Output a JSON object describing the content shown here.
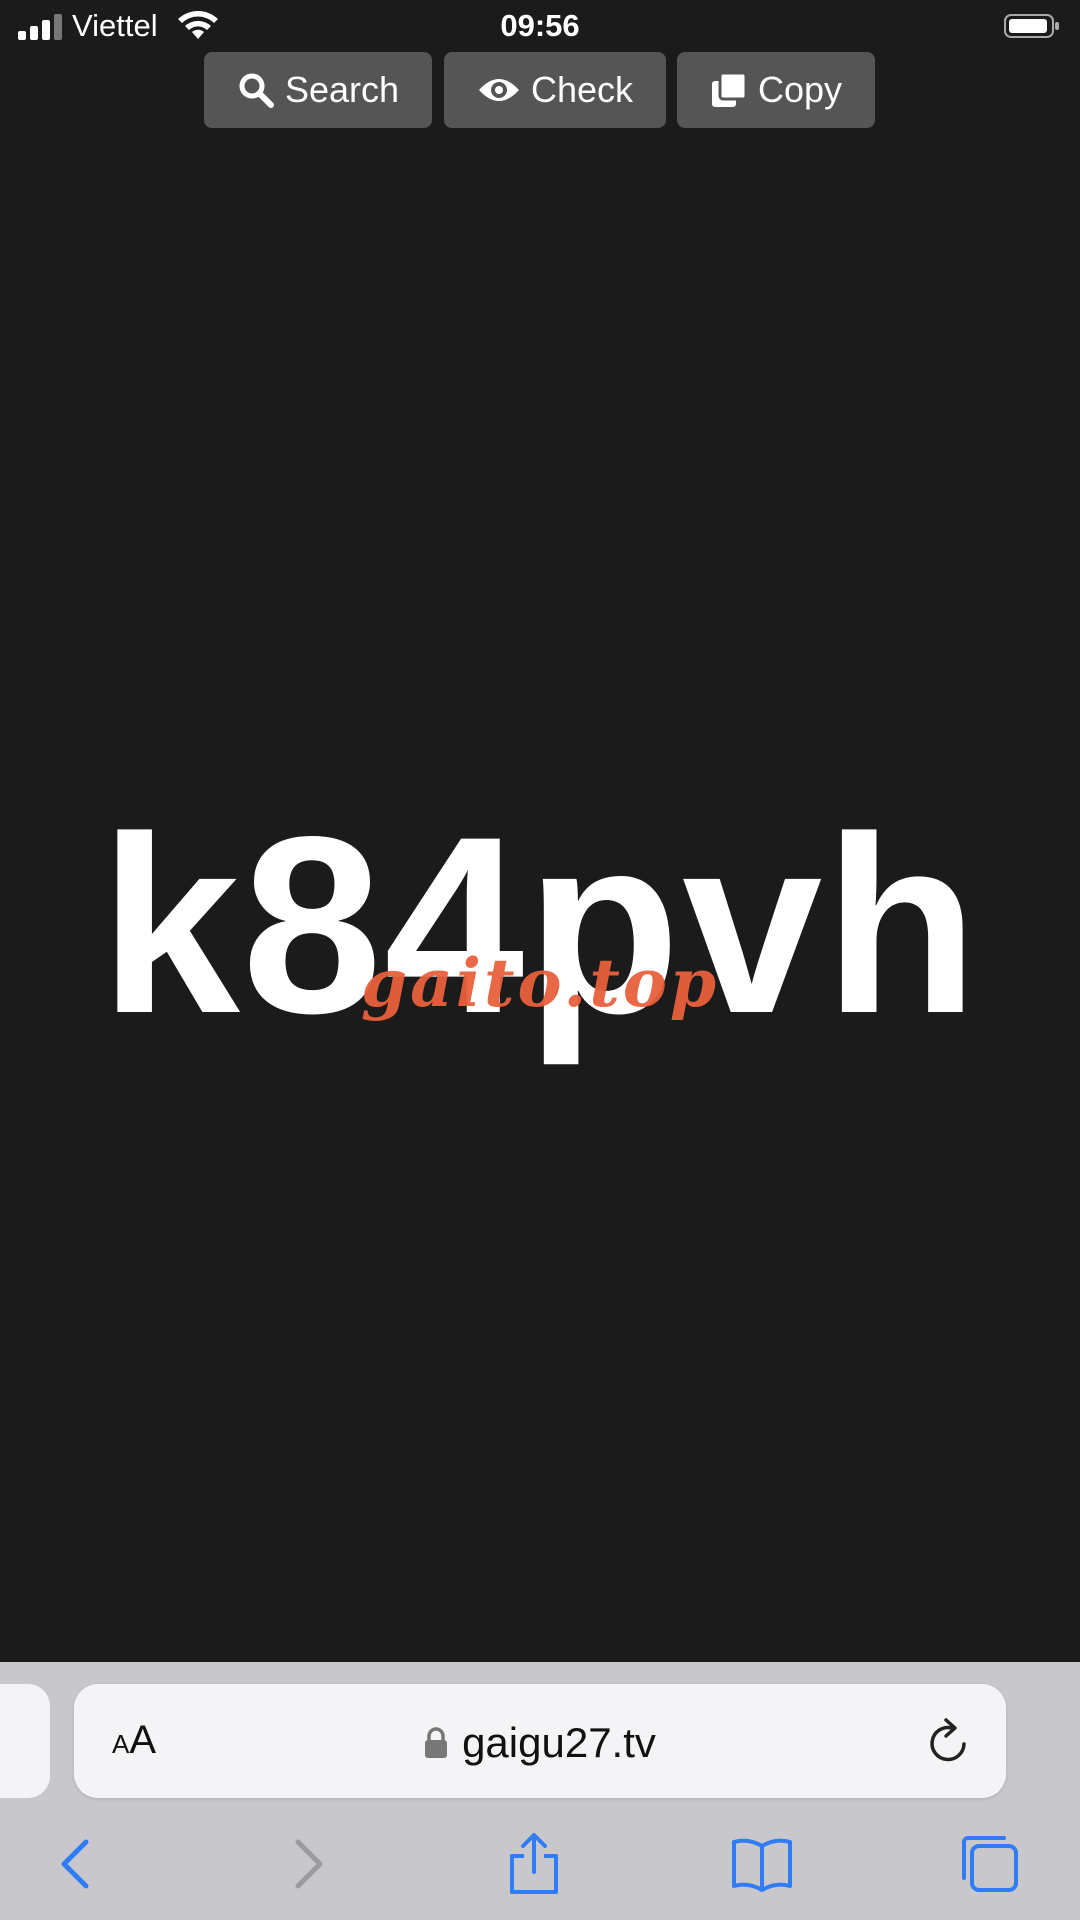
{
  "status_bar": {
    "carrier": "Viettel",
    "time": "09:56"
  },
  "actions": {
    "search_label": "Search",
    "check_label": "Check",
    "copy_label": "Copy"
  },
  "main": {
    "code": "k84pvh",
    "watermark": "gaito.top"
  },
  "browser": {
    "text_size_label_small": "A",
    "text_size_label_large": "A",
    "url": "gaigu27.tv"
  },
  "icons": {
    "search": "search-icon",
    "check": "eye-icon",
    "copy": "copy-icon",
    "lock": "lock-icon",
    "reload": "reload-icon",
    "back": "chevron-left-icon",
    "forward": "chevron-right-icon",
    "share": "share-icon",
    "bookmarks": "book-icon",
    "tabs": "tabs-icon"
  },
  "colors": {
    "accent": "#2f7cf6",
    "watermark": "#e8603c",
    "background": "#1b1b1b",
    "button": "#555555"
  }
}
